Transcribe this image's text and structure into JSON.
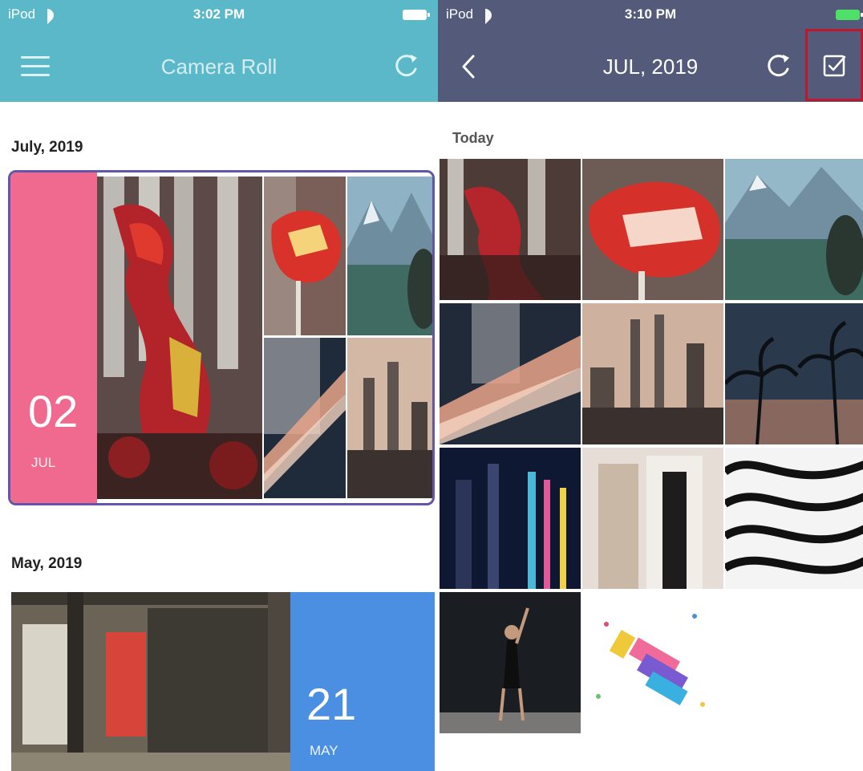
{
  "left": {
    "status": {
      "carrier": "iPod",
      "time": "3:02 PM"
    },
    "nav": {
      "title": "Camera Roll"
    },
    "groups": [
      {
        "heading": "July, 2019",
        "day": "02",
        "month": "JUL"
      },
      {
        "heading": "May, 2019",
        "day": "21",
        "month": "MAY"
      }
    ]
  },
  "right": {
    "status": {
      "carrier": "iPod",
      "time": "3:10 PM"
    },
    "nav": {
      "title": "JUL, 2019"
    },
    "section": "Today",
    "photos": [
      "dragon-dance-columns",
      "dragon-head-red",
      "mountain-lake",
      "light-trails",
      "city-skyline-dusk",
      "palm-trees-night",
      "neon-city-night",
      "people-standing",
      "wavy-pattern",
      "dancer-dark",
      "pinata-colorful"
    ]
  },
  "colors": {
    "left_header": "#5ab8c9",
    "right_header": "#545a7a",
    "july_panel": "#ef6a8e",
    "may_panel": "#4a8fe2",
    "card_border": "#6156a8",
    "select_highlight": "#c0172d"
  },
  "icons": {
    "menu": "hamburger-menu-icon",
    "refresh": "refresh-icon",
    "back": "chevron-left-icon",
    "select": "checkbox-icon"
  }
}
